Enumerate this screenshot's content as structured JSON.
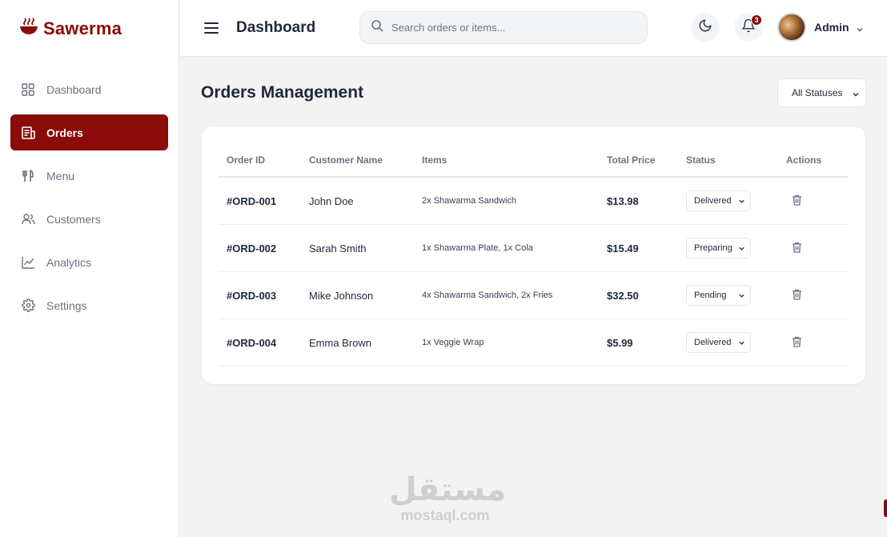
{
  "brand": {
    "name": "Sawerma",
    "icon": "bowl-icon",
    "color": "#8b0a0a"
  },
  "sidebar": {
    "items": [
      {
        "label": "Dashboard",
        "icon": "grid-icon",
        "active": false
      },
      {
        "label": "Orders",
        "icon": "receipt-icon",
        "active": true
      },
      {
        "label": "Menu",
        "icon": "utensils-icon",
        "active": false
      },
      {
        "label": "Customers",
        "icon": "users-icon",
        "active": false
      },
      {
        "label": "Analytics",
        "icon": "chart-line-icon",
        "active": false
      },
      {
        "label": "Settings",
        "icon": "gear-icon",
        "active": false
      }
    ]
  },
  "header": {
    "title": "Dashboard",
    "search_placeholder": "Search orders or items...",
    "notification_count": "3",
    "user_name": "Admin"
  },
  "main": {
    "title": "Orders Management",
    "status_filter": "All Statuses"
  },
  "table": {
    "columns": [
      "Order ID",
      "Customer Name",
      "Items",
      "Total Price",
      "Status",
      "Actions"
    ],
    "rows": [
      {
        "id": "#ORD-001",
        "customer": "John Doe",
        "items": "2x Shawarma Sandwich",
        "total": "$13.98",
        "status": "Delivered"
      },
      {
        "id": "#ORD-002",
        "customer": "Sarah Smith",
        "items": "1x Shawarma Plate, 1x Cola",
        "total": "$15.49",
        "status": "Preparing"
      },
      {
        "id": "#ORD-003",
        "customer": "Mike Johnson",
        "items": "4x Shawarma Sandwich, 2x Fries",
        "total": "$32.50",
        "status": "Pending"
      },
      {
        "id": "#ORD-004",
        "customer": "Emma Brown",
        "items": "1x Veggie Wrap",
        "total": "$5.99",
        "status": "Delivered"
      }
    ]
  },
  "watermark": {
    "arabic": "مستقل",
    "latin": "mostaql.com"
  },
  "colors": {
    "accent": "#8b0a0a",
    "background": "#f3f3f4",
    "text": "#1f2937",
    "muted": "#6b7280"
  }
}
